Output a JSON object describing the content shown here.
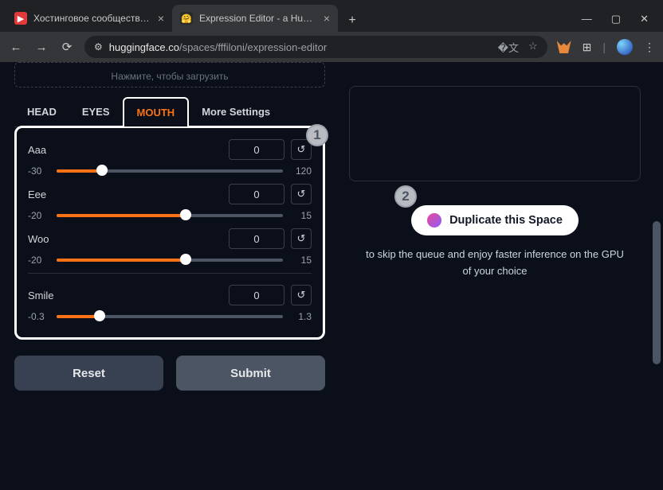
{
  "browser": {
    "tabs": [
      {
        "favicon_bg": "#e03a3a",
        "favicon_glyph": "▶",
        "title": "Хостинговое сообщество «Tin"
      },
      {
        "favicon_bg": "#fbbf24",
        "favicon_glyph": "🤗",
        "title": "Expression Editor - a Hugging F"
      }
    ],
    "url_domain": "huggingface.co",
    "url_path": "/spaces/fffiloni/expression-editor"
  },
  "upload_hint": "Нажмите, чтобы загрузить",
  "nav_tabs": {
    "head": "HEAD",
    "eyes": "EYES",
    "mouth": "MOUTH",
    "more": "More Settings"
  },
  "sliders": {
    "aaa": {
      "label": "Aaa",
      "value": "0",
      "min": "-30",
      "max": "120",
      "fill_pct": 20
    },
    "eee": {
      "label": "Eee",
      "value": "0",
      "min": "-20",
      "max": "15",
      "fill_pct": 57
    },
    "woo": {
      "label": "Woo",
      "value": "0",
      "min": "-20",
      "max": "15",
      "fill_pct": 57
    },
    "smile": {
      "label": "Smile",
      "value": "0",
      "min": "-0.3",
      "max": "1.3",
      "fill_pct": 19
    }
  },
  "reset_glyph": "↺",
  "buttons": {
    "reset": "Reset",
    "submit": "Submit",
    "duplicate": "Duplicate this Space"
  },
  "right": {
    "sub": "to skip the queue and enjoy faster inference on the GPU of your choice"
  },
  "badges": {
    "one": "1",
    "two": "2"
  }
}
